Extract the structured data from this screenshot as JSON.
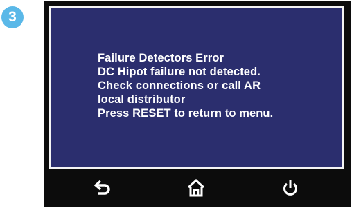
{
  "step_badge": "3",
  "screen": {
    "message_lines": [
      "Failure Detectors Error",
      "DC Hipot failure not detected.",
      "Check connections or call AR",
      "local distributor",
      "Press RESET to return to menu."
    ]
  },
  "nav": {
    "buttons": [
      {
        "icon": "back-arrow-icon"
      },
      {
        "icon": "home-icon"
      },
      {
        "icon": "power-icon"
      }
    ]
  },
  "colors": {
    "screen_background": "#2b2e6e",
    "screen_border": "#f4f4f4",
    "device_bezel": "#0c0c0c",
    "badge": "#5ab8e8",
    "text": "#ffffff"
  }
}
